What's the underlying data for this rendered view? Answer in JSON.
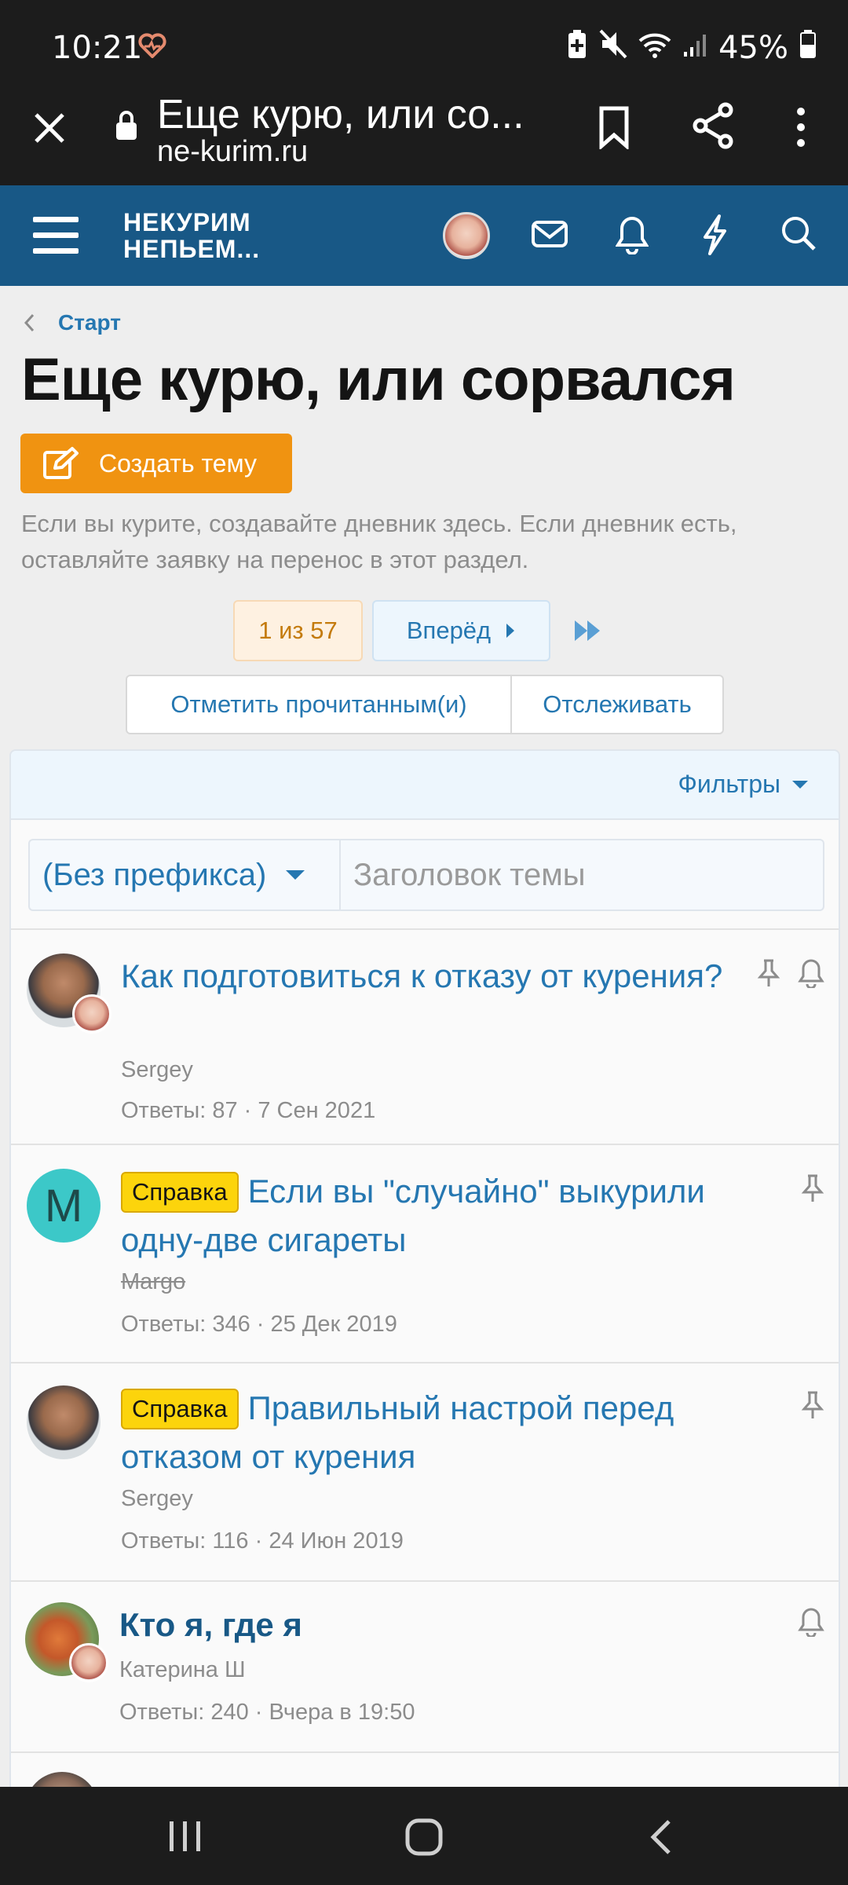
{
  "status": {
    "time": "10:21",
    "battery": "45%"
  },
  "browser": {
    "title": "Еще курю, или со...",
    "url": "ne-kurim.ru"
  },
  "site": {
    "logo_line1": "НЕКУРИМ",
    "logo_line2": "НЕПЬЕМ..."
  },
  "breadcrumb": "Старт",
  "page_title": "Еще курю, или сорвался",
  "create_button": "Создать тему",
  "description": "Если вы курите, создавайте дневник здесь. Если дневник есть, оставляйте заявку на перенос в этот раздел.",
  "pagination": {
    "current": "1 из 57",
    "next": "Вперёд"
  },
  "actions": {
    "mark_read": "Отметить прочитанным(и)",
    "watch": "Отслеживать"
  },
  "filters": {
    "label": "Фильтры",
    "prefix": "(Без префикса)",
    "title_placeholder": "Заголовок темы"
  },
  "threads": [
    {
      "title": "Как подготовиться к отказу от курения?",
      "author": "Sergey",
      "meta": "Ответы: 87 · 7 Сен 2021"
    },
    {
      "prefix": "Справка",
      "title": "Если вы \"случайно\" выкурили одну-две сигареты",
      "author": "Margo",
      "avatar_letter": "M",
      "meta": "Ответы: 346 · 25 Дек 2019"
    },
    {
      "prefix": "Справка",
      "title": "Правильный настрой перед отказом от курения",
      "author": "Sergey",
      "meta": "Ответы: 116 · 24 Июн 2019"
    },
    {
      "title": "Кто я, где я",
      "author": "Катерина Ш",
      "meta": "Ответы: 240 · Вчера в 19:50"
    }
  ],
  "colors": {
    "header": "#185886",
    "accent": "#2577b1",
    "create": "#f09311",
    "badge": "#fcd40c",
    "avatar_m": "#3cc8c8"
  }
}
